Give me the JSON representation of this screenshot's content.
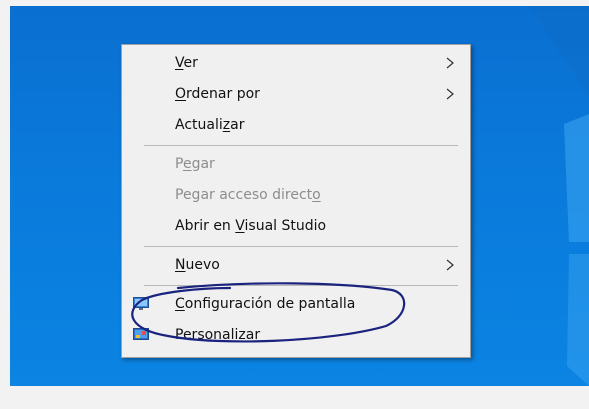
{
  "context_menu": {
    "items": [
      {
        "prefix": "",
        "key": "V",
        "suffix": "er",
        "disabled": false,
        "submenu": true
      },
      {
        "prefix": "",
        "key": "O",
        "suffix": "rdenar por",
        "disabled": false,
        "submenu": true
      },
      {
        "prefix": "Actuali",
        "key": "z",
        "suffix": "ar",
        "disabled": false,
        "submenu": false
      },
      {
        "prefix": "P",
        "key": "e",
        "suffix": "gar",
        "disabled": true,
        "submenu": false
      },
      {
        "prefix": "Pegar acceso direct",
        "key": "o",
        "suffix": "",
        "disabled": true,
        "submenu": false
      },
      {
        "prefix": "Abrir en ",
        "key": "V",
        "suffix": "isual Studio",
        "disabled": false,
        "submenu": false
      },
      {
        "prefix": "",
        "key": "N",
        "suffix": "uevo",
        "disabled": false,
        "submenu": true
      },
      {
        "prefix": "",
        "key": "C",
        "suffix": "onfiguración de pantalla",
        "disabled": false,
        "submenu": false,
        "icon": "display-settings-icon"
      },
      {
        "prefix": "Persona",
        "key": "l",
        "suffix": "izar",
        "disabled": false,
        "submenu": false,
        "icon": "personalize-icon"
      }
    ]
  },
  "colors": {
    "desktop": "#0a79da",
    "annotation": "#1a237e"
  }
}
